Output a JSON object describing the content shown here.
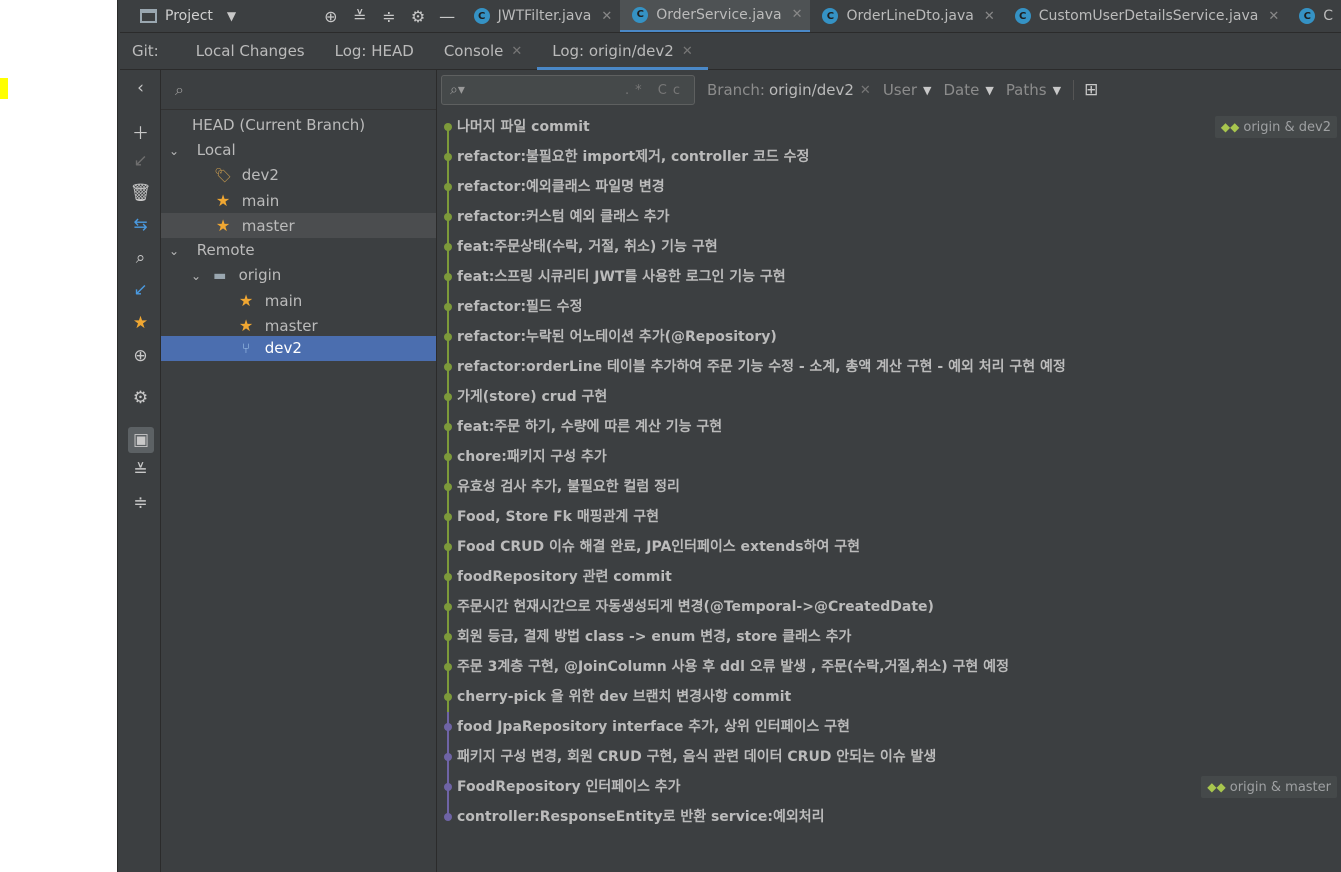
{
  "topbar": {
    "project_label": "Project",
    "tabs": [
      {
        "label": "JWTFilter.java",
        "active": false
      },
      {
        "label": "OrderService.java",
        "active": true
      },
      {
        "label": "OrderLineDto.java",
        "active": false
      },
      {
        "label": "CustomUserDetailsService.java",
        "active": false
      },
      {
        "label": "C",
        "active": false
      }
    ]
  },
  "gitbar": {
    "prefix": "Git:",
    "tabs": [
      {
        "label": "Local Changes",
        "active": false
      },
      {
        "label": "Log: HEAD",
        "active": false
      },
      {
        "label": "Console",
        "active": false
      },
      {
        "label": "Log: origin/dev2",
        "active": true
      }
    ]
  },
  "branches": {
    "head_label": "HEAD (Current Branch)",
    "local_label": "Local",
    "local_items": [
      "dev2",
      "main",
      "master"
    ],
    "remote_label": "Remote",
    "origin_label": "origin",
    "remote_items": [
      "main",
      "master",
      "dev2"
    ]
  },
  "log_toolbar": {
    "regex_hint": ".*",
    "case_hint": "Cc",
    "branch_label": "Branch:",
    "branch_value": "origin/dev2",
    "user_label": "User",
    "date_label": "Date",
    "paths_label": "Paths"
  },
  "colors": {
    "green_branch": "#7d9a3a",
    "purple_branch": "#6f64a6",
    "selection_blue": "#4b6eaf",
    "accent": "#4a88c7"
  },
  "commits": [
    {
      "msg": "나머지 파일 commit",
      "ref": "origin & dev2",
      "branch": "green"
    },
    {
      "msg": "refactor:불필요한 import제거, controller 코드 수정",
      "branch": "green"
    },
    {
      "msg": "refactor:예외클래스 파일명 변경",
      "branch": "green"
    },
    {
      "msg": "refactor:커스텀 예외 클래스 추가",
      "branch": "green"
    },
    {
      "msg": "feat:주문상태(수락, 거절, 취소) 기능 구현",
      "branch": "green"
    },
    {
      "msg": "feat:스프링 시큐리티 JWT를 사용한 로그인 기능 구현",
      "branch": "green"
    },
    {
      "msg": "refactor:필드 수정",
      "branch": "green"
    },
    {
      "msg": "refactor:누락된 어노테이션 추가(@Repository)",
      "branch": "green"
    },
    {
      "msg": "refactor:orderLine 테이블 추가하여 주문 기능 수정 - 소계, 총액 계산 구현 - 예외 처리 구현 예정",
      "branch": "green"
    },
    {
      "msg": "가게(store) crud 구현",
      "branch": "green"
    },
    {
      "msg": "feat:주문 하기, 수량에 따른 계산 기능 구현",
      "branch": "green"
    },
    {
      "msg": "chore:패키지 구성 추가",
      "branch": "green"
    },
    {
      "msg": "유효성 검사 추가, 불필요한 컬럼 정리",
      "branch": "green"
    },
    {
      "msg": "Food, Store Fk 매핑관계 구현",
      "branch": "green"
    },
    {
      "msg": "Food CRUD 이슈 해결 완료, JPA인터페이스 extends하여 구현",
      "branch": "green"
    },
    {
      "msg": "foodRepository 관련 commit",
      "branch": "green"
    },
    {
      "msg": "주문시간 현재시간으로 자동생성되게 변경(@Temporal->@CreatedDate)",
      "branch": "green"
    },
    {
      "msg": "회원 등급, 결제 방법 class -> enum 변경, store 클래스 추가",
      "branch": "green"
    },
    {
      "msg": "주문 3계층 구현, @JoinColumn 사용 후 ddl 오류 발생 , 주문(수락,거절,취소) 구현 예정",
      "branch": "green"
    },
    {
      "msg": "cherry-pick 을 위한 dev 브랜치 변경사항 commit",
      "branch": "green"
    },
    {
      "msg": "food JpaRepository interface 추가, 상위 인터페이스 구현",
      "branch": "purple"
    },
    {
      "msg": "패키지 구성 변경, 회원 CRUD 구현, 음식 관련 데이터 CRUD 안되는 이슈 발생",
      "branch": "purple"
    },
    {
      "msg": "FoodRepository 인터페이스 추가",
      "ref": "origin & master",
      "branch": "purple"
    },
    {
      "msg": "controller:ResponseEntity로 반환 service:예외처리",
      "branch": "purple"
    }
  ]
}
